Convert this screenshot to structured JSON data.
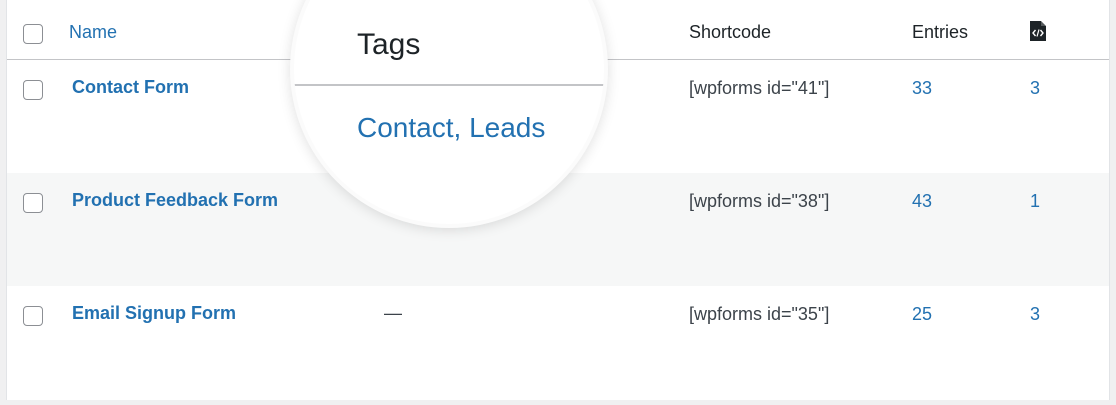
{
  "header": {
    "name_label": "Name",
    "tags_label": "Tags",
    "shortcode_label": "Shortcode",
    "entries_label": "Entries",
    "icon": "code-document-icon"
  },
  "rows": [
    {
      "name": "Contact Form",
      "tags": "Contact, Leads",
      "shortcode": "[wpforms id=\"41\"]",
      "entries": "33",
      "count": "3"
    },
    {
      "name": "Product Feedback Form",
      "tags": "",
      "shortcode": "[wpforms id=\"38\"]",
      "entries": "43",
      "count": "1"
    },
    {
      "name": "Email Signup Form",
      "tags": "—",
      "shortcode": "[wpforms id=\"35\"]",
      "entries": "25",
      "count": "3"
    }
  ],
  "lens": {
    "title": "Tags",
    "tag_1": "Contact",
    "separator": ", ",
    "tag_2": "Leads"
  },
  "colors": {
    "link": "#2271b1",
    "alt_row": "#f6f7f7",
    "border": "#c3c4c7"
  }
}
